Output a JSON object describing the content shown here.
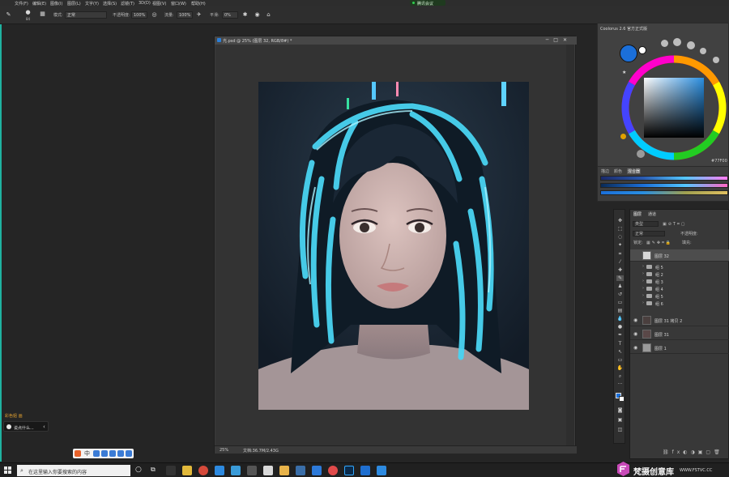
{
  "menu": {
    "items": [
      "文件(F)",
      "编辑(E)",
      "图像(I)",
      "图层(L)",
      "文字(Y)",
      "选择(S)",
      "滤镜(T)",
      "3D(D)",
      "视图(V)",
      "窗口(W)",
      "帮助(H)"
    ],
    "status_text": "腾讯会议"
  },
  "options": {
    "brush_size": "84",
    "mode_label": "模式:",
    "mode_value": "正常",
    "opacity_label": "不透明度:",
    "opacity_value": "100%",
    "flow_label": "流量:",
    "flow_value": "100%",
    "smoothing_label": "平滑:",
    "smoothing_value": "0%"
  },
  "document": {
    "title": "光.psd @ 25% (图层 32, RGB/8#) *",
    "zoom": "25%",
    "info": "文档:36.7M/2.43G"
  },
  "color_panel": {
    "title": "Coolorus 2.6 官方正式版",
    "hex": "#77F00",
    "colors": {
      "fg": "#1b6fd9",
      "bg": "#ffffff",
      "square": "#2a8ee0"
    }
  },
  "slider_panel": {
    "tabs": [
      "描边",
      "颜色",
      "混合器"
    ]
  },
  "layers_panel": {
    "tabs": [
      "图层",
      "通道"
    ],
    "filter_label": "类型",
    "blend": "正常",
    "opacity_label": "不透明度:",
    "lock_label": "锁定:",
    "fill_label": "填充:",
    "layers": [
      {
        "name": "图层 32",
        "selected": true
      },
      {
        "name": "组 5"
      },
      {
        "name": "组 2"
      },
      {
        "name": "组 3"
      },
      {
        "name": "组 4"
      },
      {
        "name": "组 5"
      },
      {
        "name": "组 6"
      },
      {
        "name": "图层 31 拷贝 2"
      },
      {
        "name": "图层 31"
      },
      {
        "name": "图层 1"
      }
    ]
  },
  "taskbar": {
    "search_placeholder": "在这里输入你要搜索的内容"
  },
  "chat": {
    "label": "彩色姐 画",
    "text": "说点什么..."
  },
  "watermark": {
    "text": "梵摄创意库",
    "url": "WWW.FSTVC.CC"
  }
}
